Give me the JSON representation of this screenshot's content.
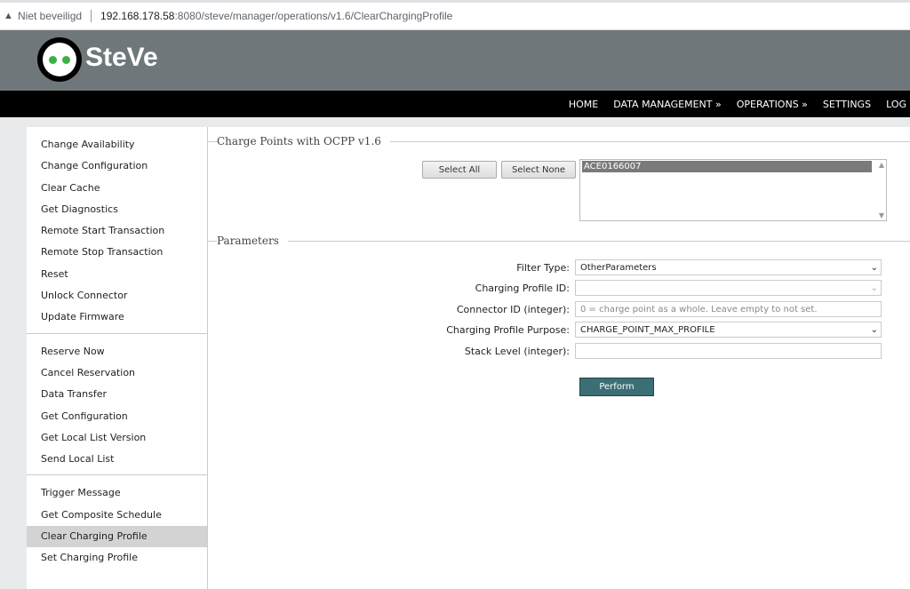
{
  "browser": {
    "security": "Niet beveiligd",
    "host": "192.168.178.58",
    "path": ":8080/steve/manager/operations/v1.6/ClearChargingProfile"
  },
  "brand": "SteVe",
  "nav": [
    "HOME",
    "DATA MANAGEMENT »",
    "OPERATIONS »",
    "SETTINGS",
    "LOG"
  ],
  "sidebar": {
    "groups": [
      [
        "Change Availability",
        "Change Configuration",
        "Clear Cache",
        "Get Diagnostics",
        "Remote Start Transaction",
        "Remote Stop Transaction",
        "Reset",
        "Unlock Connector",
        "Update Firmware"
      ],
      [
        "Reserve Now",
        "Cancel Reservation",
        "Data Transfer",
        "Get Configuration",
        "Get Local List Version",
        "Send Local List"
      ],
      [
        "Trigger Message",
        "Get Composite Schedule",
        "Clear Charging Profile",
        "Set Charging Profile"
      ]
    ],
    "active": "Clear Charging Profile"
  },
  "charge_points": {
    "legend": "Charge Points with OCPP v1.6",
    "select_all": "Select All",
    "select_none": "Select None",
    "options": [
      "ACE0166007"
    ]
  },
  "params": {
    "legend": "Parameters",
    "filter_type": {
      "label": "Filter Type:",
      "value": "OtherParameters"
    },
    "profile_id": {
      "label": "Charging Profile ID:",
      "value": ""
    },
    "connector_id": {
      "label": "Connector ID (integer):",
      "placeholder": "0 = charge point as a whole. Leave empty to not set."
    },
    "purpose": {
      "label": "Charging Profile Purpose:",
      "value": "CHARGE_POINT_MAX_PROFILE"
    },
    "stack_level": {
      "label": "Stack Level (integer):",
      "value": ""
    },
    "perform": "Perform"
  }
}
